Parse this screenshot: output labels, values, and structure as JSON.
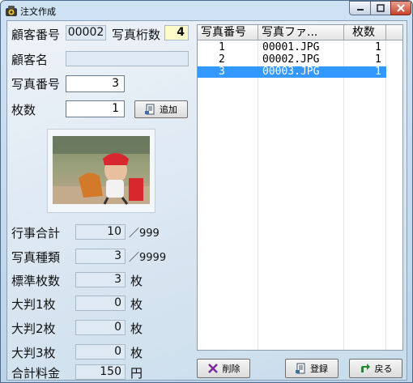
{
  "window": {
    "title": "注文作成"
  },
  "form": {
    "customer_no_label": "顧客番号",
    "customer_no": "00002",
    "photo_digits_label": "写真桁数",
    "photo_digits": "4",
    "customer_name_label": "顧客名",
    "customer_name": "",
    "photo_no_label": "写真番号",
    "photo_no": "3",
    "count_label": "枚数",
    "count": "1",
    "add_button": "追加"
  },
  "stats": [
    {
      "label": "行事合計",
      "value": "10",
      "suffix": "／999"
    },
    {
      "label": "写真種類",
      "value": "3",
      "suffix": "／9999"
    },
    {
      "label": "標準枚数",
      "value": "3",
      "suffix": "枚"
    },
    {
      "label": "大判1枚",
      "value": "0",
      "suffix": "枚"
    },
    {
      "label": "大判2枚",
      "value": "0",
      "suffix": "枚"
    },
    {
      "label": "大判3枚",
      "value": "0",
      "suffix": "枚"
    },
    {
      "label": "合計料金",
      "value": "150",
      "suffix": "円"
    }
  ],
  "table": {
    "headers": [
      "写真番号",
      "写真ファ...",
      "枚数"
    ],
    "rows": [
      {
        "no": "1",
        "file": "00001.JPG",
        "count": "1",
        "selected": false
      },
      {
        "no": "2",
        "file": "00002.JPG",
        "count": "1",
        "selected": false
      },
      {
        "no": "3",
        "file": "00003.JPG",
        "count": "1",
        "selected": true
      }
    ]
  },
  "buttons": {
    "delete": "削除",
    "register": "登録",
    "back": "戻る"
  },
  "icons": {
    "app": "app-icon",
    "add": "document-icon",
    "delete": "delete-x-icon",
    "register": "document-icon",
    "back": "arrow-back-icon"
  },
  "colors": {
    "selection": "#3398ff",
    "highlight_field": "#fdfbc9"
  }
}
